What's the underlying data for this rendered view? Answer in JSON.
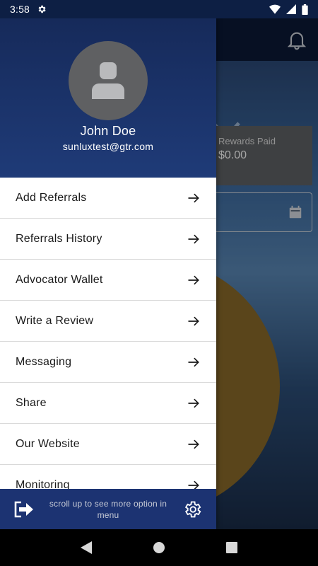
{
  "status_bar": {
    "time": "3:58",
    "icons": [
      "gear-icon",
      "wifi-icon",
      "signal-icon",
      "battery-icon"
    ]
  },
  "background": {
    "rewards_label": "Rewards Paid",
    "rewards_value": "$0.00",
    "icons": [
      "bell-icon",
      "calendar-icon"
    ]
  },
  "drawer": {
    "user": {
      "name": "John Doe",
      "email": "sunluxtest@gtr.com"
    },
    "menu": [
      {
        "label": "Add Referrals"
      },
      {
        "label": "Referrals History"
      },
      {
        "label": "Advocator Wallet"
      },
      {
        "label": "Write a Review"
      },
      {
        "label": "Messaging"
      },
      {
        "label": "Share"
      },
      {
        "label": "Our Website"
      },
      {
        "label": "Monitoring"
      }
    ],
    "footer": {
      "hint": "scroll up to see more option in menu",
      "icons": [
        "logout-icon",
        "settings-icon"
      ]
    }
  },
  "colors": {
    "drawer_header": "#1f3b78",
    "drawer_footer": "#1c3372",
    "status_bar": "#0d1f44"
  }
}
